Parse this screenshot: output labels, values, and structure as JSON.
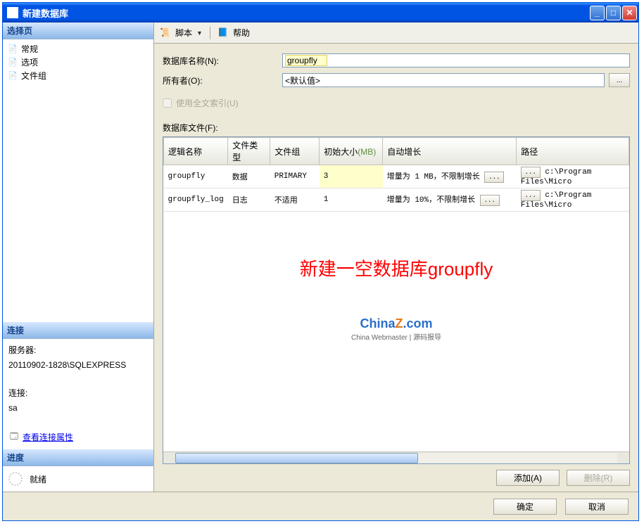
{
  "window": {
    "title": "新建数据库"
  },
  "left": {
    "select_page_header": "选择页",
    "items": [
      "常规",
      "选项",
      "文件组"
    ],
    "connection_header": "连接",
    "server_label": "服务器:",
    "server_value": "20110902-1828\\SQLEXPRESS",
    "conn_label": "连接:",
    "conn_value": "sa",
    "view_props": "查看连接属性",
    "progress_header": "进度",
    "progress_status": "就绪"
  },
  "toolbar": {
    "script": "脚本",
    "help": "帮助"
  },
  "form": {
    "db_name_label": "数据库名称(N):",
    "db_name_value": "groupfly",
    "owner_label": "所有者(O):",
    "owner_value": "<默认值>",
    "fulltext_label": "使用全文索引(U)",
    "files_label": "数据库文件(F):"
  },
  "grid": {
    "headers": {
      "logical_name": "逻辑名称",
      "file_type": "文件类型",
      "filegroup": "文件组",
      "init_size": "初始大小",
      "mb": "(MB)",
      "autogrow": "自动增长",
      "path": "路径"
    },
    "rows": [
      {
        "logical_name": "groupfly",
        "file_type": "数据",
        "filegroup": "PRIMARY",
        "init_size": "3",
        "autogrow": "增量为 1 MB，不限制增长",
        "path": "c:\\Program Files\\Micro"
      },
      {
        "logical_name": "groupfly_log",
        "file_type": "日志",
        "filegroup": "不适用",
        "init_size": "1",
        "autogrow": "增量为 10%，不限制增长",
        "path": "c:\\Program Files\\Micro"
      }
    ]
  },
  "overlay": {
    "annotation": "新建一空数据库groupfly",
    "watermark_sub": "China Webmaster | 源码报导"
  },
  "buttons": {
    "add": "添加(A)",
    "remove": "删除(R)",
    "ok": "确定",
    "cancel": "取消",
    "ellipsis": "..."
  }
}
